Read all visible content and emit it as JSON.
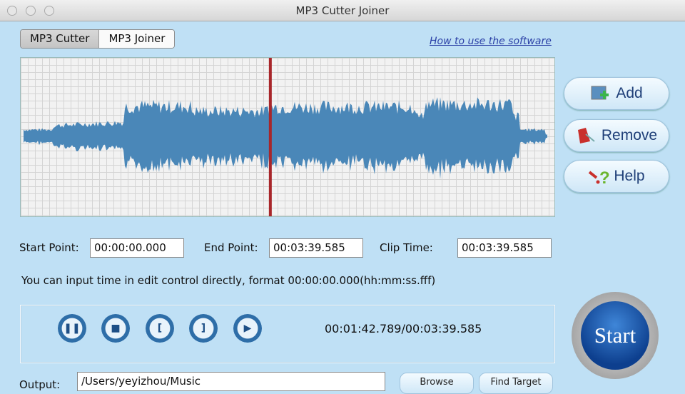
{
  "window": {
    "title": "MP3 Cutter Joiner"
  },
  "tabs": [
    {
      "label": "MP3 Cutter"
    },
    {
      "label": "MP3 Joiner"
    }
  ],
  "help_link": "How to use the software",
  "side_buttons": {
    "add": "Add",
    "remove": "Remove",
    "help": "Help"
  },
  "fields": {
    "start_label": "Start Point:",
    "start_value": "00:00:00.000",
    "end_label": "End Point:",
    "end_value": "00:03:39.585",
    "clip_label": "Clip Time:",
    "clip_value": "00:03:39.585"
  },
  "info": "You can input time in edit control directly, format 00:00:00.000(hh:mm:ss.fff)",
  "player": {
    "time": "00:01:42.789/00:03:39.585",
    "playhead_fraction": 0.4677
  },
  "start_label": "Start",
  "output": {
    "label": "Output:",
    "value": "/Users/yeyizhou/Music",
    "browse": "Browse",
    "find_target": "Find Target"
  },
  "colors": {
    "wave": "#4a87b8",
    "playhead": "#a8262a",
    "background": "#bfe0f5"
  }
}
